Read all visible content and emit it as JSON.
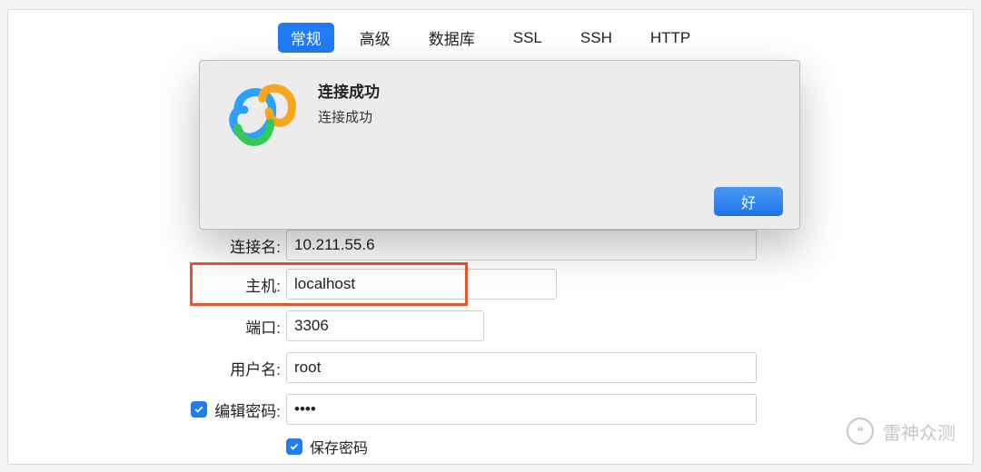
{
  "tabs": {
    "general": "常规",
    "advanced": "高级",
    "database": "数据库",
    "ssl": "SSL",
    "ssh": "SSH",
    "http": "HTTP"
  },
  "form": {
    "conn_label": "连接名:",
    "conn_value": "10.211.55.6",
    "host_label": "主机:",
    "host_value": "localhost",
    "port_label": "端口:",
    "port_value": "3306",
    "user_label": "用户名:",
    "user_value": "root",
    "pwd_label": "编辑密码:",
    "pwd_value": "••••",
    "save_label": "保存密码"
  },
  "modal": {
    "title": "连接成功",
    "msg": "连接成功",
    "ok": "好"
  },
  "watermark": "雷神众测",
  "colors": {
    "accent": "#1f7bf6",
    "highlight": "#e4582e"
  }
}
